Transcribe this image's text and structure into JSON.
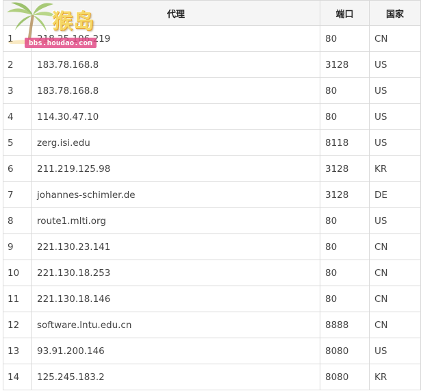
{
  "table": {
    "headers": {
      "index": "",
      "proxy": "代理",
      "port": "端口",
      "country": "国家"
    },
    "rows": [
      {
        "index": "1",
        "proxy": "218.25.106.219",
        "port": "80",
        "country": "CN"
      },
      {
        "index": "2",
        "proxy": "183.78.168.8",
        "port": "3128",
        "country": "US"
      },
      {
        "index": "3",
        "proxy": "183.78.168.8",
        "port": "80",
        "country": "US"
      },
      {
        "index": "4",
        "proxy": "114.30.47.10",
        "port": "80",
        "country": "US"
      },
      {
        "index": "5",
        "proxy": "zerg.isi.edu",
        "port": "8118",
        "country": "US"
      },
      {
        "index": "6",
        "proxy": "211.219.125.98",
        "port": "3128",
        "country": "KR"
      },
      {
        "index": "7",
        "proxy": "johannes-schimler.de",
        "port": "3128",
        "country": "DE"
      },
      {
        "index": "8",
        "proxy": "route1.mlti.org",
        "port": "80",
        "country": "US"
      },
      {
        "index": "9",
        "proxy": "221.130.23.141",
        "port": "80",
        "country": "CN"
      },
      {
        "index": "10",
        "proxy": "221.130.18.253",
        "port": "80",
        "country": "CN"
      },
      {
        "index": "11",
        "proxy": "221.130.18.146",
        "port": "80",
        "country": "CN"
      },
      {
        "index": "12",
        "proxy": "software.lntu.edu.cn",
        "port": "8888",
        "country": "CN"
      },
      {
        "index": "13",
        "proxy": "93.91.200.146",
        "port": "8080",
        "country": "US"
      },
      {
        "index": "14",
        "proxy": "125.245.183.2",
        "port": "8080",
        "country": "KR"
      }
    ]
  },
  "watermark": {
    "title": "猴岛",
    "url": "bbs.houdao.com",
    "icon": "palm-tree-icon"
  },
  "colors": {
    "border": "#d9d9d9",
    "header_bg": "#f5f5f5",
    "text": "#444444",
    "watermark_gold": "#f6d75a",
    "watermark_pink": "#e24d88"
  }
}
